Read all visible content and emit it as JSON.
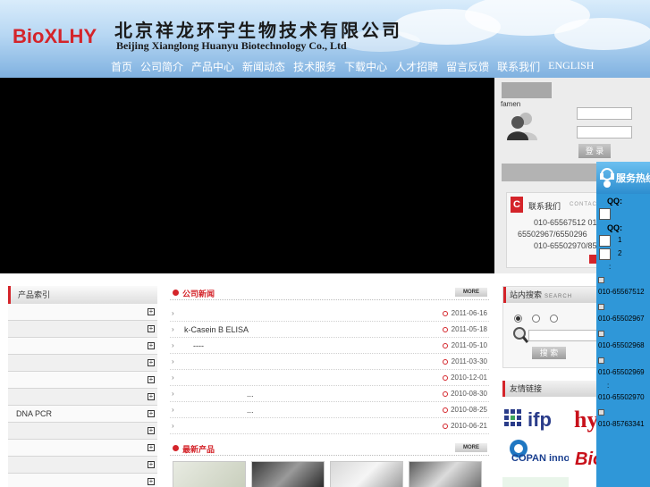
{
  "header": {
    "logo": "BioXLHY",
    "title_cn": "北京祥龙环宇生物技术有限公司",
    "title_en": "Beijing Xianglong Huanyu Biotechnology Co., Ltd"
  },
  "nav": {
    "items": [
      "首页",
      "公司简介",
      "产品中心",
      "新闻动态",
      "技术服务",
      "下载中心",
      "人才招聘",
      "留言反馈",
      "联系我们",
      "ENGLISH"
    ]
  },
  "login": {
    "famen": "famen",
    "login_button": "登 录",
    "contact_title": "联系我们",
    "contact_en": "CONTACT",
    "phones": [
      "010-65567512 01",
      "65502967/6550296",
      "010-65502970/85"
    ]
  },
  "product_index": {
    "title": "产品索引",
    "rows": [
      "",
      "",
      "",
      "",
      "",
      "",
      "DNA    PCR",
      "",
      "",
      "",
      "",
      ""
    ]
  },
  "news": {
    "title": "公司新闻",
    "more": "MORE",
    "items": [
      {
        "text": "",
        "date": "2011-06-16"
      },
      {
        "text": "k-Casein B ELISA",
        "date": "2011-05-18"
      },
      {
        "text": "    ----",
        "date": "2011-05-10"
      },
      {
        "text": "",
        "date": "2011-03-30"
      },
      {
        "text": "",
        "date": "2010-12-01"
      },
      {
        "text": "                            ...",
        "date": "2010-08-30"
      },
      {
        "text": "                            ...",
        "date": "2010-08-25"
      },
      {
        "text": "",
        "date": "2010-06-21"
      }
    ]
  },
  "new_products": {
    "title": "最新产品",
    "more": "MORE"
  },
  "site_search": {
    "title": "站内搜索",
    "title_en": "SEARCH",
    "button": "搜 索"
  },
  "links": {
    "title": "友情链接",
    "logos": [
      "ifp",
      "hy",
      "COPAN innovation",
      "BioXL"
    ]
  },
  "service": {
    "title": "服务热线",
    "qq_label_1": "QQ:",
    "qq_label_2": "QQ:",
    "qq_items": [
      "1",
      "2"
    ],
    "colon": ":",
    "numbers": [
      "010-65567512",
      "010-65502967",
      "010-65502968",
      "010-65502969",
      "010-65502970",
      "010-85763341"
    ]
  },
  "colors": {
    "accent": "#d4242a",
    "nav_text": "#ffffff",
    "service_bg": "#2f97d8"
  }
}
